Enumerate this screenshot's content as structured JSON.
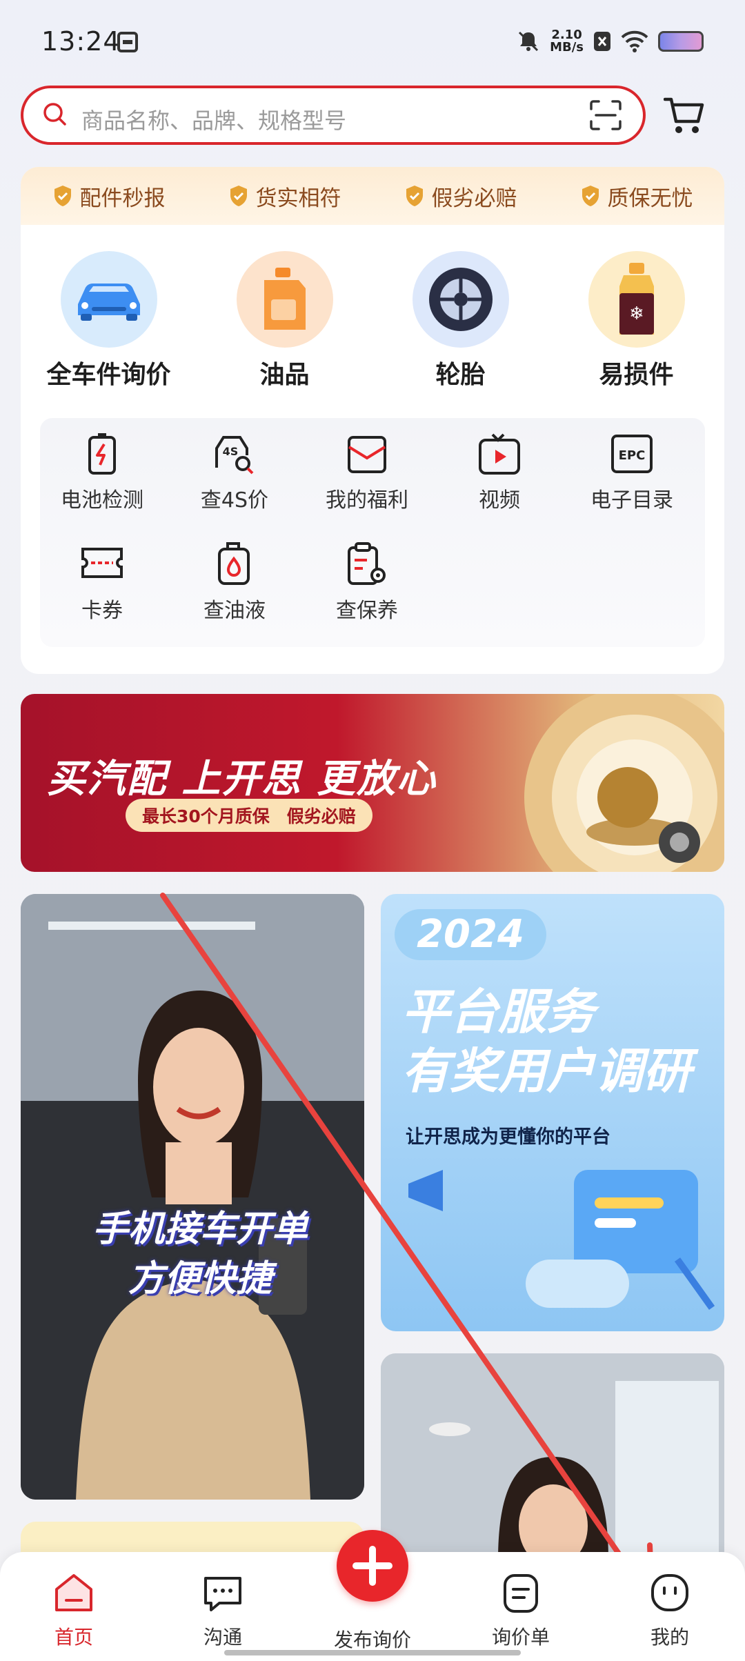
{
  "status_bar": {
    "time": "13:24",
    "speed_value": "2.10",
    "speed_unit": "MB/s",
    "icons": [
      "calendar-icon",
      "mute-icon",
      "close-box-icon",
      "wifi-icon",
      "battery-icon"
    ]
  },
  "search": {
    "placeholder": "商品名称、品牌、规格型号"
  },
  "promises": [
    "配件秒报",
    "货实相符",
    "假劣必赔",
    "质保无忧"
  ],
  "categories": [
    {
      "label": "全车件询价",
      "icon": "car-icon"
    },
    {
      "label": "油品",
      "icon": "oil-can-icon"
    },
    {
      "label": "轮胎",
      "icon": "tire-icon"
    },
    {
      "label": "易损件",
      "icon": "coolant-bottle-icon"
    }
  ],
  "tools": [
    {
      "label": "电池检测",
      "icon": "battery-check-icon"
    },
    {
      "label": "查4S价",
      "icon": "4s-price-icon"
    },
    {
      "label": "我的福利",
      "icon": "gift-envelope-icon"
    },
    {
      "label": "视频",
      "icon": "video-tv-icon"
    },
    {
      "label": "电子目录",
      "icon": "epc-catalog-icon"
    },
    {
      "label": "卡券",
      "icon": "coupon-icon"
    },
    {
      "label": "查油液",
      "icon": "fluid-bottle-icon"
    },
    {
      "label": "查保养",
      "icon": "maintenance-clipboard-icon"
    }
  ],
  "tool_icon_texts": {
    "4s": "4S",
    "epc": "EPC"
  },
  "banner": {
    "title": "买汽配 上开思 更放心",
    "pill": "最长30个月质保　假劣必赔"
  },
  "feed": {
    "card1_caption_line1": "手机接车开单",
    "card1_caption_line2": "方便快捷",
    "card2_year": "2024",
    "card2_title_line1": "平台服务",
    "card2_title_line2": "有奖用户调研",
    "card2_subtitle": "让开思成为更懂你的平台"
  },
  "nav": {
    "items": [
      {
        "label": "首页",
        "icon": "home-icon",
        "active": true
      },
      {
        "label": "沟通",
        "icon": "chat-icon",
        "active": false
      },
      {
        "label": "发布询价",
        "icon": "plus-icon",
        "active": false
      },
      {
        "label": "询价单",
        "icon": "inquiry-list-icon",
        "active": false
      },
      {
        "label": "我的",
        "icon": "profile-face-icon",
        "active": false
      }
    ]
  },
  "colors": {
    "accent": "#d9262c",
    "promise_text": "#8a4a1e"
  }
}
